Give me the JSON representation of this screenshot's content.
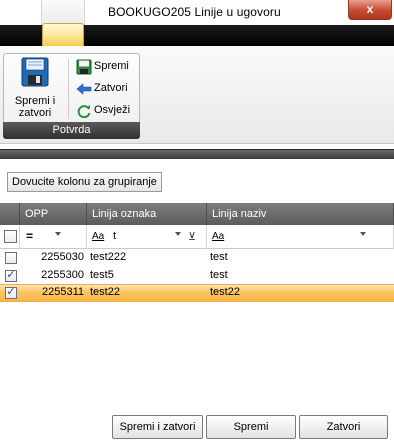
{
  "window": {
    "title": "BOOKUGO205  Linije u ugovoru",
    "close_glyph": "x"
  },
  "ribbon": {
    "group_label": "Potvrda",
    "big_button": {
      "label": "Spremi i\nzatvori",
      "icon": "floppy-save-close-icon"
    },
    "small_buttons": [
      {
        "label": "Spremi",
        "icon": "floppy-save-icon"
      },
      {
        "label": "Zatvori",
        "icon": "arrow-left-icon"
      },
      {
        "label": "Osvježi",
        "icon": "refresh-icon"
      }
    ]
  },
  "groupby": {
    "label": "Dovucite kolonu za grupiranje"
  },
  "grid": {
    "columns": [
      "OPP",
      "Linija oznaka",
      "Linija naziv"
    ],
    "filter": {
      "opp_operator": "=",
      "oznaka_prefix": "Aa",
      "oznaka_value": "t",
      "naziv_prefix": "Aa",
      "naziv_value": ""
    },
    "rows": [
      {
        "checked": false,
        "selected": false,
        "opp": "2255030",
        "oznaka": "test222",
        "naziv": "test"
      },
      {
        "checked": true,
        "selected": false,
        "opp": "2255300",
        "oznaka": "test5",
        "naziv": "test"
      },
      {
        "checked": true,
        "selected": true,
        "opp": "2255311",
        "oznaka": "test22",
        "naziv": "test22"
      }
    ],
    "colors": {
      "selected_row": "#f9b746",
      "header": "#6d6d6d"
    }
  },
  "buttons": {
    "save_close": "Spremi i zatvori",
    "save": "Spremi",
    "close": "Zatvori"
  }
}
